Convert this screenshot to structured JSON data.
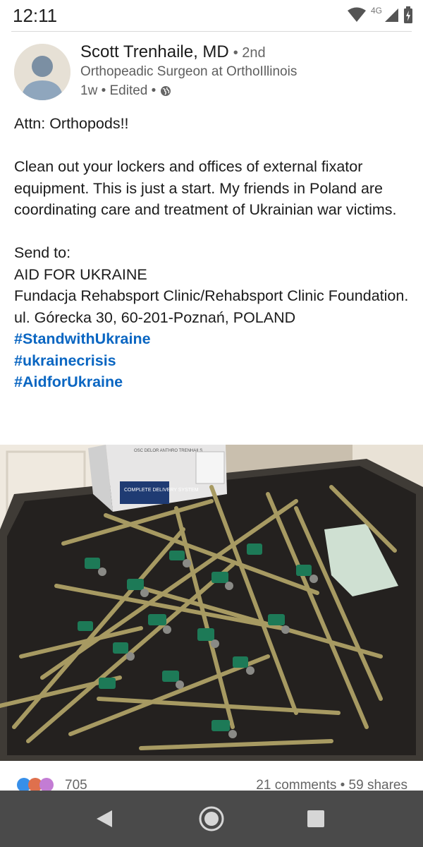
{
  "status_bar": {
    "time": "12:11",
    "network": "4G"
  },
  "post": {
    "author": "Scott Trenhaile, MD",
    "degree": "• 2nd",
    "headline": "Orthopeadic Surgeon at OrthoIllinois",
    "meta": "1w • Edited •",
    "paragraphs": [
      "Attn: Orthopods!!",
      "Clean out your lockers and offices of external fixator equipment.  This is just a start. My friends in Poland are coordinating care and treatment of Ukrainian war victims."
    ],
    "address_lines": [
      "Send to:",
      "AID FOR UKRAINE",
      "Fundacja Rehabsport Clinic/Rehabsport Clinic Foundation.",
      "ul. Górecka 30, 60-201-Poznań, POLAND"
    ],
    "hashtags": [
      "#StandwithUkraine",
      "#ukrainecrisis",
      "#AidforUkraine"
    ],
    "image_labels": {
      "box_title": "COMPLETE DELIVERY SYSTEM",
      "box_top": "OSC DELOR ANTHRO TRENHAILS"
    },
    "reaction_count": "705",
    "comments_shares": "21 comments • 59 shares"
  },
  "icons": {
    "wifi": "wifi-icon",
    "signal": "signal-icon",
    "battery": "battery-icon",
    "globe": "globe-icon",
    "back": "back-icon",
    "home": "home-icon",
    "recents": "recents-icon"
  },
  "colors": {
    "link": "#0a66c2",
    "navbar": "#4a4a4a",
    "text": "#1b1b1b",
    "muted": "#5e5e5e"
  }
}
